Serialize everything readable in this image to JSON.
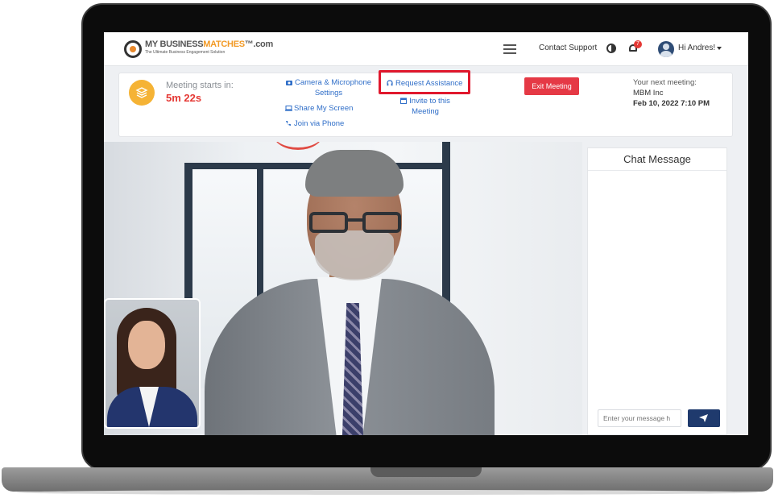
{
  "navbar": {
    "logo_text_a": "MY BUSINESS",
    "logo_text_b": "MATCHES",
    "logo_text_c": "™.com",
    "logo_tagline": "The Ultimate Business Engagement Solution",
    "contact_support": "Contact Support",
    "notification_count": "7",
    "user_greeting": "Hi Andres!"
  },
  "meeting": {
    "starts_label": "Meeting starts in:",
    "countdown": "5m 22s",
    "camera_settings": "Camera & Microphone Settings",
    "share_screen": "Share My Screen",
    "join_phone": "Join via Phone",
    "request_assistance": "Request Assistance",
    "invite": "Invite to this Meeting",
    "exit_button": "Exit Meeting",
    "next_label": "Your next meeting:",
    "next_company": "MBM Inc",
    "next_date": "Feb 10, 2022 7:10 PM"
  },
  "chat": {
    "title": "Chat Message",
    "input_placeholder": "Enter your message h"
  },
  "colors": {
    "accent_blue": "#2f6ec8",
    "countdown_red": "#e53935",
    "highlight_red": "#e0182d",
    "send_navy": "#1f3a6d"
  }
}
